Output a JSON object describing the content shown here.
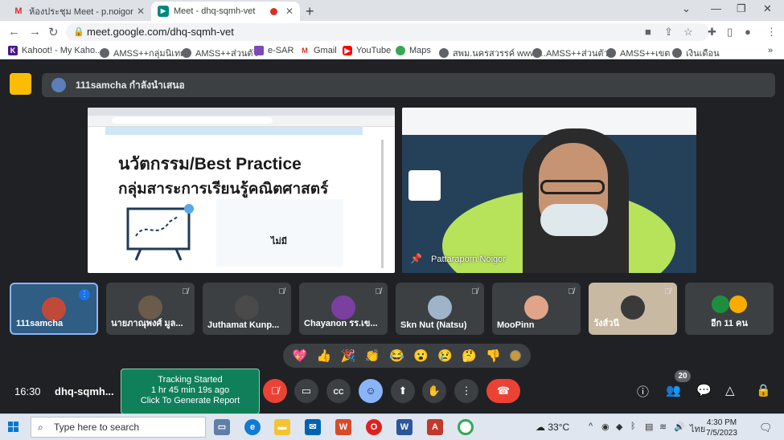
{
  "browser": {
    "tabs": [
      {
        "title": "ห้องประชุม Meet - p.noigor@gmail",
        "icon": "gmail-icon",
        "active": false
      },
      {
        "title": "Meet - dhq-sqmh-vet",
        "icon": "meet-icon",
        "active": true
      }
    ],
    "url": "meet.google.com/dhq-sqmh-vet",
    "bookmarks": [
      "Kahoot! - My Kaho...",
      "AMSS++กลุ่มนิเทศ",
      "AMSS++ส่วนตัว",
      "e-SAR",
      "Gmail",
      "YouTube",
      "Maps",
      "สพม.นครสวรรค์ www....",
      "AMSS++ส่วนตัว",
      "AMSS++เขต",
      "เงินเดือน"
    ]
  },
  "meet": {
    "presenting_text": "111samcha กำลังนำเสนอ",
    "slide": {
      "title_line1": "นวัตกรรม/Best Practice",
      "title_line2": "กลุ่มสาระการเรียนรู้คณิตศาสตร์",
      "sub": "ไม่มี"
    },
    "speaker_name": "Pattaraporn Noigor",
    "participants": [
      {
        "name": "111samcha",
        "muted": false,
        "self": true
      },
      {
        "name": "นายภาณุพงศ์ มูล...",
        "muted": true
      },
      {
        "name": "Juthamat Kunp...",
        "muted": true
      },
      {
        "name": "Chayanon รร.เข...",
        "muted": true
      },
      {
        "name": "Skn Nut (Natsu)",
        "muted": true
      },
      {
        "name": "MooPinn",
        "muted": true
      },
      {
        "name": "วังส์วนี",
        "muted": true
      },
      {
        "name": "อีก 11 คน",
        "muted": false
      }
    ],
    "reactions": [
      "💖",
      "👍",
      "🎉",
      "👏",
      "😂",
      "😮",
      "😢",
      "🤔",
      "👎"
    ],
    "time": "16:30",
    "meeting_code": "dhq-sqmh...",
    "tracking": {
      "line1": "Tracking Started",
      "line2": "1 hr 45 min 19s ago",
      "line3": "Click To Generate Report"
    },
    "people_count": "20"
  },
  "taskbar": {
    "search_placeholder": "Type here to search",
    "temperature": "33°C",
    "language": "ไทย",
    "time": "4:30 PM",
    "date": "7/5/2023"
  }
}
